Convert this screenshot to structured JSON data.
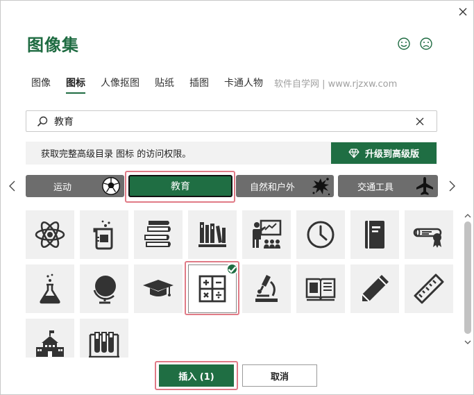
{
  "dialog": {
    "title": "图像集"
  },
  "tabs": [
    {
      "label": "图像",
      "active": false
    },
    {
      "label": "图标",
      "active": true
    },
    {
      "label": "人像抠图",
      "active": false
    },
    {
      "label": "贴纸",
      "active": false
    },
    {
      "label": "插图",
      "active": false
    },
    {
      "label": "卡通人物",
      "active": false
    }
  ],
  "watermark": "软件自学网 | www.rjzxw.com",
  "search": {
    "value": "教育",
    "placeholder": ""
  },
  "notice": {
    "text": "获取完整高级目录 图标 的访问权限。",
    "upgrade_label": "升级到高级版"
  },
  "categories": [
    {
      "label": "运动",
      "icon": "soccer-ball-icon"
    },
    {
      "label": "教育",
      "selected": true
    },
    {
      "label": "自然和户外",
      "icon": "splat-icon"
    },
    {
      "label": "交通工具",
      "icon": "airplane-icon"
    }
  ],
  "icons": [
    "atom-icon",
    "beaker-icon",
    "book-stack-icon",
    "bookshelf-icon",
    "classroom-teacher-icon",
    "clock-icon",
    "notebook-icon",
    "diploma-icon",
    "flask-icon",
    "globe-icon",
    "graduation-cap-icon",
    "calculator-math-icon",
    "microscope-icon",
    "open-book-icon",
    "pencil-icon",
    "ruler-icon",
    "school-building-icon",
    "test-tubes-icon"
  ],
  "selected_icon": "calculator-math-icon",
  "footer": {
    "insert_label": "插入 (1)",
    "cancel_label": "取消"
  },
  "colors": {
    "accent": "#1f6e43",
    "title": "#1e6b41",
    "category": "#6d6d6d",
    "highlight": "#e07a86"
  }
}
